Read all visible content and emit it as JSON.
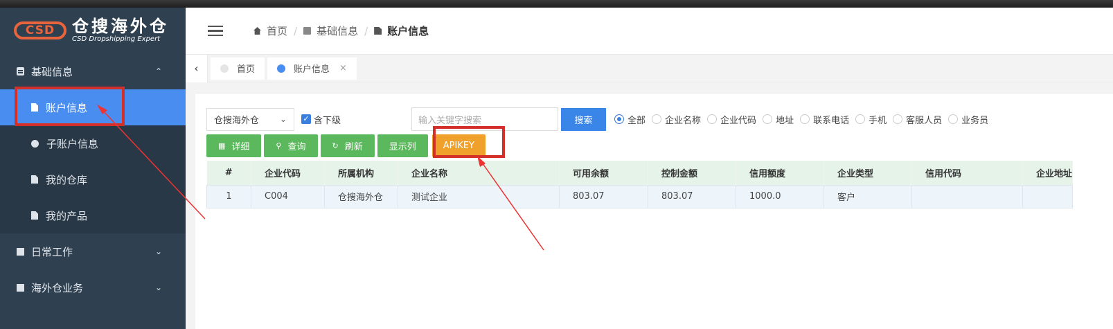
{
  "logo": {
    "mark": "CSD",
    "title_cn": "仓搜海外仓",
    "title_en": "CSD Dropshipping Expert"
  },
  "sidebar": {
    "groups": [
      {
        "label": "基础信息",
        "expanded": true
      },
      {
        "label": "日常工作",
        "expanded": false
      },
      {
        "label": "海外仓业务",
        "expanded": false
      }
    ],
    "items": [
      {
        "label": "账户信息",
        "active": true
      },
      {
        "label": "子账户信息"
      },
      {
        "label": "我的仓库"
      },
      {
        "label": "我的产品"
      }
    ]
  },
  "breadcrumb": {
    "home": "首页",
    "parent": "基础信息",
    "current": "账户信息"
  },
  "tabs": [
    {
      "label": "首页"
    },
    {
      "label": "账户信息",
      "closable": true,
      "close": "×"
    }
  ],
  "filters": {
    "warehouse_select": "仓搜海外仓",
    "include_sub": "含下级",
    "keyword_placeholder": "输入关键字搜索",
    "search_label": "搜索",
    "radios": [
      "全部",
      "企业名称",
      "企业代码",
      "地址",
      "联系电话",
      "手机",
      "客服人员",
      "业务员"
    ]
  },
  "buttons": {
    "detail": "详细",
    "query": "查询",
    "refresh": "刷新",
    "columns": "显示列",
    "apikey": "APIKEY"
  },
  "table": {
    "headers": [
      "#",
      "企业代码",
      "所属机构",
      "企业名称",
      "可用余额",
      "控制金额",
      "信用额度",
      "企业类型",
      "信用代码",
      "企业地址"
    ],
    "rows": [
      [
        "1",
        "C004",
        "仓搜海外仓",
        "测试企业",
        "803.07",
        "803.07",
        "1000.0",
        "客户",
        "",
        ""
      ]
    ]
  },
  "colors": {
    "sidebar_bg": "#2f4050",
    "active_blue": "#4a8df0",
    "green": "#5cb85c",
    "orange": "#f0a12b",
    "annotation_red": "#d3302a"
  }
}
